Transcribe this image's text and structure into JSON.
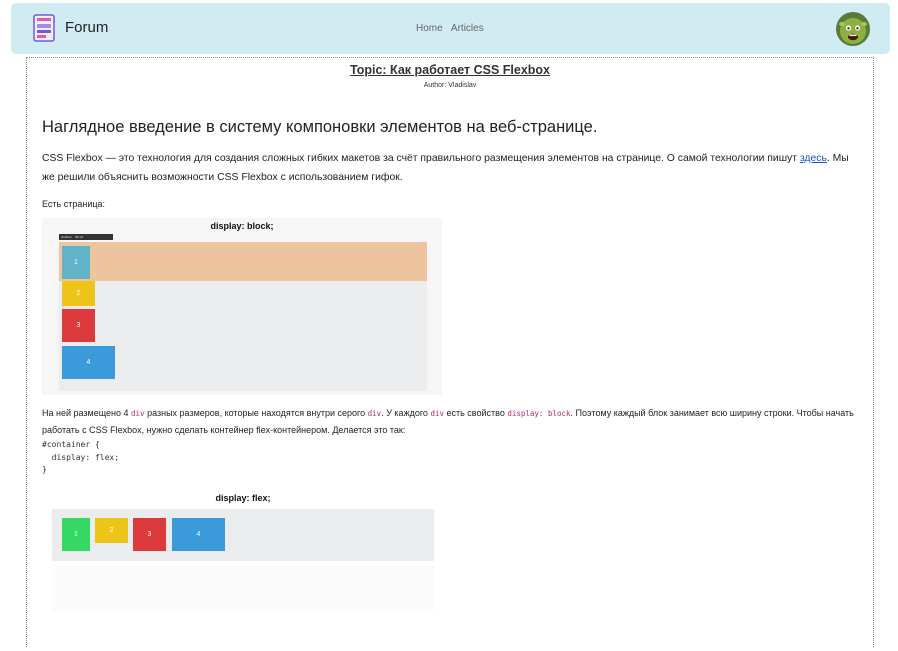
{
  "navbar": {
    "brand": "Forum",
    "links": [
      "Home",
      "Articles"
    ]
  },
  "article": {
    "topic": "Topic: Как работает CSS Flexbox",
    "author": "Author: Vladislav",
    "heading": "Наглядное введение в систему компоновки элементов на веб-странице.",
    "intro_text": "CSS Flexbox — это технология для создания сложных гибких макетов за счёт правильного размещения элементов на странице. О самой технологии пишут ",
    "intro_link": "здесь",
    "intro_text2": ". Мы же решили объяснить возможности CSS Flexbox с использованием гифок.",
    "page_label": "Есть страница:",
    "fig1": {
      "title": "display: block;",
      "tooltip": "div#item · 28×34",
      "boxes": [
        "1",
        "2",
        "3",
        "4"
      ]
    },
    "para2": {
      "t1": "На ней размещено 4 ",
      "c1": "div",
      "t2": " разных размеров, которые находятся внутри серого ",
      "c2": "div",
      "t3": ". У каждого ",
      "c3": "div",
      "t4": " есть свойство ",
      "c4": "display: block",
      "t5": ". Поэтому каждый блок занимает всю ширину строки. Чтобы начать работать с CSS Flexbox, нужно сделать контейнер flex-контейнером. Делается это так:"
    },
    "code": "#container {\n  display: flex;\n}",
    "fig2": {
      "title": "display: flex;",
      "boxes": [
        "1",
        "2",
        "3",
        "4"
      ]
    }
  },
  "colors": {
    "navbar_bg": "#d1ebf2",
    "box_blue": "#3b9ad9",
    "box_yellow": "#efc419",
    "box_red": "#dc3a3c",
    "box_green": "#35d865",
    "box_teal": "#60b3c8",
    "peach": "#eec49e"
  }
}
